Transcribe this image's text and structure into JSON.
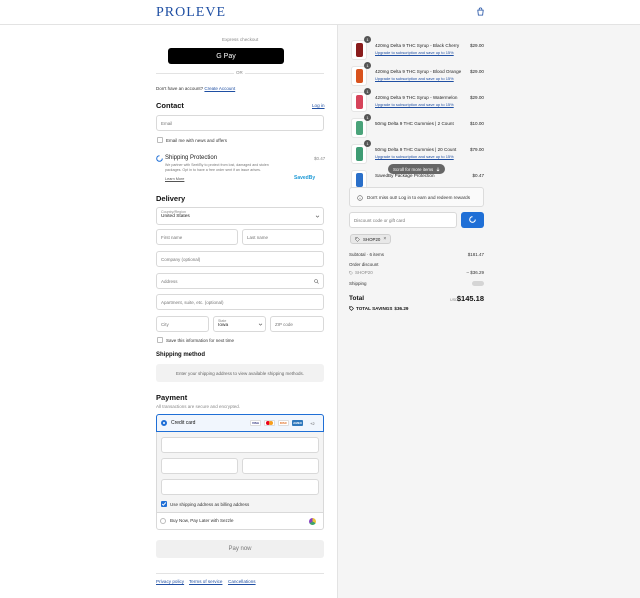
{
  "header": {
    "logo": "PROLEVE",
    "cart_icon": "shopping-bag-icon"
  },
  "express": {
    "title": "Express checkout",
    "gpay_label": "G Pay",
    "or": "OR"
  },
  "account": {
    "prompt": "Don't have an account?",
    "create": "Create Account"
  },
  "contact": {
    "title": "Contact",
    "login": "Log in",
    "email_placeholder": "Email",
    "news_label": "Email me with news and offers"
  },
  "shipping_protection": {
    "title": "Shipping Protection",
    "price": "$0.47",
    "desc": "We partner with Seel/By to protect from lost, damaged and stolen packages. Opt in to have a free order sent if an issue arises.",
    "learn_more": "Learn More",
    "brand": "SavedBy"
  },
  "delivery": {
    "title": "Delivery",
    "country_label": "Country/Region",
    "country_value": "United States",
    "first_name": "First name",
    "last_name": "Last name",
    "company": "Company (optional)",
    "address": "Address",
    "apartment": "Apartment, suite, etc. (optional)",
    "city": "City",
    "state_label": "State",
    "state_value": "Iowa",
    "zip": "ZIP code",
    "save_info": "Save this information for next time"
  },
  "shipping_method": {
    "title": "Shipping method",
    "note": "Enter your shipping address to view available shipping methods."
  },
  "payment": {
    "title": "Payment",
    "subtitle": "All transactions are secure and encrypted.",
    "credit_card": "Credit card",
    "more_cards": "+2",
    "cards": [
      "VISA",
      "MC",
      "DISC",
      "AMEX"
    ],
    "billing_same": "Use shipping address as billing address",
    "sezzle": "Buy Now, Pay Later with Sezzle",
    "pay_now": "Pay now"
  },
  "footer": {
    "links": [
      "Privacy policy",
      "Terms of service",
      "Cancellations"
    ]
  },
  "cart": {
    "items": [
      {
        "name": "420mg Delta 9 THC Syrup - Black Cherry",
        "sub": "Upgrade to subscription and save up to 15%",
        "price": "$29.00",
        "qty": "1",
        "color": "#8a1c1c"
      },
      {
        "name": "420mg Delta 9 THC Syrup - Blood Orange",
        "sub": "Upgrade to subscription and save up to 15%",
        "price": "$29.00",
        "qty": "1",
        "color": "#d9531e"
      },
      {
        "name": "420mg Delta 9 THC Syrup - Watermelon",
        "sub": "Upgrade to subscription and save up to 15%",
        "price": "$29.00",
        "qty": "1",
        "color": "#d6435a"
      },
      {
        "name": "50mg Delta 9 THC Gummies | 2 Count",
        "sub": "",
        "price": "$10.00",
        "qty": "1",
        "color": "#4aa37a"
      },
      {
        "name": "50mg Delta 9 THC Gummies | 20 Count",
        "sub": "Upgrade to subscription and save up to 15%",
        "price": "$79.00",
        "qty": "1",
        "color": "#3f9c74"
      },
      {
        "name": "SavedBy Package Protection",
        "sub": "",
        "price": "$0.47",
        "qty": "",
        "color": "#2a6fc9"
      }
    ],
    "scroll_hint": "Scroll for more items",
    "rewards": "Don't miss out! Log in to earn and redeem rewards",
    "rewards_link": "Log in",
    "discount_placeholder": "Discount code or gift card",
    "tag": "SHOP20",
    "subtotal_label": "Subtotal · 6 items",
    "subtotal": "$181.47",
    "order_discount": "Order discount",
    "discount_code": "SHOP20",
    "discount_amount": "– $36.29",
    "shipping_label": "Shipping",
    "total_label": "Total",
    "currency": "USD",
    "total": "$145.18",
    "savings_label": "TOTAL SAVINGS",
    "savings": "$36.29"
  }
}
